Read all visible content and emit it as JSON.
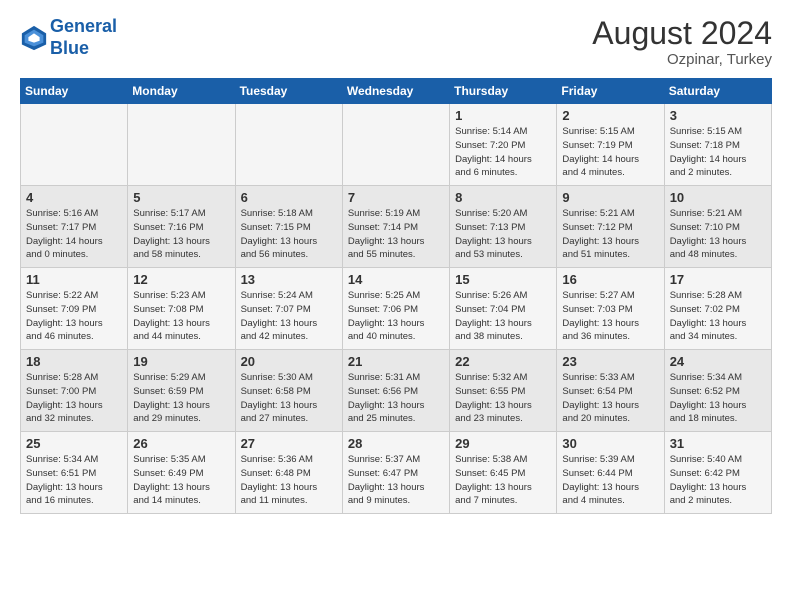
{
  "header": {
    "logo_line1": "General",
    "logo_line2": "Blue",
    "month": "August 2024",
    "location": "Ozpinar, Turkey"
  },
  "days_of_week": [
    "Sunday",
    "Monday",
    "Tuesday",
    "Wednesday",
    "Thursday",
    "Friday",
    "Saturday"
  ],
  "weeks": [
    [
      {
        "day": "",
        "info": ""
      },
      {
        "day": "",
        "info": ""
      },
      {
        "day": "",
        "info": ""
      },
      {
        "day": "",
        "info": ""
      },
      {
        "day": "1",
        "info": "Sunrise: 5:14 AM\nSunset: 7:20 PM\nDaylight: 14 hours\nand 6 minutes."
      },
      {
        "day": "2",
        "info": "Sunrise: 5:15 AM\nSunset: 7:19 PM\nDaylight: 14 hours\nand 4 minutes."
      },
      {
        "day": "3",
        "info": "Sunrise: 5:15 AM\nSunset: 7:18 PM\nDaylight: 14 hours\nand 2 minutes."
      }
    ],
    [
      {
        "day": "4",
        "info": "Sunrise: 5:16 AM\nSunset: 7:17 PM\nDaylight: 14 hours\nand 0 minutes."
      },
      {
        "day": "5",
        "info": "Sunrise: 5:17 AM\nSunset: 7:16 PM\nDaylight: 13 hours\nand 58 minutes."
      },
      {
        "day": "6",
        "info": "Sunrise: 5:18 AM\nSunset: 7:15 PM\nDaylight: 13 hours\nand 56 minutes."
      },
      {
        "day": "7",
        "info": "Sunrise: 5:19 AM\nSunset: 7:14 PM\nDaylight: 13 hours\nand 55 minutes."
      },
      {
        "day": "8",
        "info": "Sunrise: 5:20 AM\nSunset: 7:13 PM\nDaylight: 13 hours\nand 53 minutes."
      },
      {
        "day": "9",
        "info": "Sunrise: 5:21 AM\nSunset: 7:12 PM\nDaylight: 13 hours\nand 51 minutes."
      },
      {
        "day": "10",
        "info": "Sunrise: 5:21 AM\nSunset: 7:10 PM\nDaylight: 13 hours\nand 48 minutes."
      }
    ],
    [
      {
        "day": "11",
        "info": "Sunrise: 5:22 AM\nSunset: 7:09 PM\nDaylight: 13 hours\nand 46 minutes."
      },
      {
        "day": "12",
        "info": "Sunrise: 5:23 AM\nSunset: 7:08 PM\nDaylight: 13 hours\nand 44 minutes."
      },
      {
        "day": "13",
        "info": "Sunrise: 5:24 AM\nSunset: 7:07 PM\nDaylight: 13 hours\nand 42 minutes."
      },
      {
        "day": "14",
        "info": "Sunrise: 5:25 AM\nSunset: 7:06 PM\nDaylight: 13 hours\nand 40 minutes."
      },
      {
        "day": "15",
        "info": "Sunrise: 5:26 AM\nSunset: 7:04 PM\nDaylight: 13 hours\nand 38 minutes."
      },
      {
        "day": "16",
        "info": "Sunrise: 5:27 AM\nSunset: 7:03 PM\nDaylight: 13 hours\nand 36 minutes."
      },
      {
        "day": "17",
        "info": "Sunrise: 5:28 AM\nSunset: 7:02 PM\nDaylight: 13 hours\nand 34 minutes."
      }
    ],
    [
      {
        "day": "18",
        "info": "Sunrise: 5:28 AM\nSunset: 7:00 PM\nDaylight: 13 hours\nand 32 minutes."
      },
      {
        "day": "19",
        "info": "Sunrise: 5:29 AM\nSunset: 6:59 PM\nDaylight: 13 hours\nand 29 minutes."
      },
      {
        "day": "20",
        "info": "Sunrise: 5:30 AM\nSunset: 6:58 PM\nDaylight: 13 hours\nand 27 minutes."
      },
      {
        "day": "21",
        "info": "Sunrise: 5:31 AM\nSunset: 6:56 PM\nDaylight: 13 hours\nand 25 minutes."
      },
      {
        "day": "22",
        "info": "Sunrise: 5:32 AM\nSunset: 6:55 PM\nDaylight: 13 hours\nand 23 minutes."
      },
      {
        "day": "23",
        "info": "Sunrise: 5:33 AM\nSunset: 6:54 PM\nDaylight: 13 hours\nand 20 minutes."
      },
      {
        "day": "24",
        "info": "Sunrise: 5:34 AM\nSunset: 6:52 PM\nDaylight: 13 hours\nand 18 minutes."
      }
    ],
    [
      {
        "day": "25",
        "info": "Sunrise: 5:34 AM\nSunset: 6:51 PM\nDaylight: 13 hours\nand 16 minutes."
      },
      {
        "day": "26",
        "info": "Sunrise: 5:35 AM\nSunset: 6:49 PM\nDaylight: 13 hours\nand 14 minutes."
      },
      {
        "day": "27",
        "info": "Sunrise: 5:36 AM\nSunset: 6:48 PM\nDaylight: 13 hours\nand 11 minutes."
      },
      {
        "day": "28",
        "info": "Sunrise: 5:37 AM\nSunset: 6:47 PM\nDaylight: 13 hours\nand 9 minutes."
      },
      {
        "day": "29",
        "info": "Sunrise: 5:38 AM\nSunset: 6:45 PM\nDaylight: 13 hours\nand 7 minutes."
      },
      {
        "day": "30",
        "info": "Sunrise: 5:39 AM\nSunset: 6:44 PM\nDaylight: 13 hours\nand 4 minutes."
      },
      {
        "day": "31",
        "info": "Sunrise: 5:40 AM\nSunset: 6:42 PM\nDaylight: 13 hours\nand 2 minutes."
      }
    ]
  ]
}
